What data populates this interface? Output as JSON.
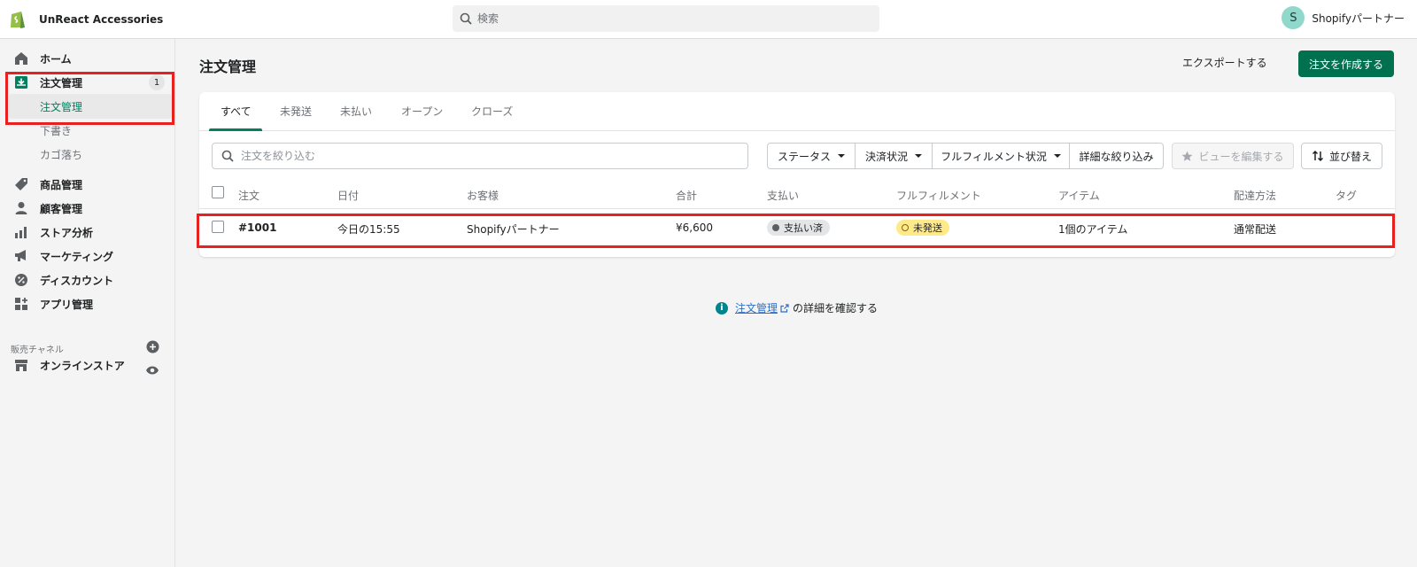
{
  "topbar": {
    "store_name": "UnReact Accessories",
    "search_placeholder": "検索",
    "user_initial": "S",
    "user_name": "Shopifyパートナー"
  },
  "sidebar": {
    "items": [
      {
        "label": "ホーム",
        "icon": "home-icon"
      },
      {
        "label": "注文管理",
        "icon": "orders-icon",
        "badge": "1"
      },
      {
        "label": "商品管理",
        "icon": "products-icon"
      },
      {
        "label": "顧客管理",
        "icon": "customers-icon"
      },
      {
        "label": "ストア分析",
        "icon": "analytics-icon"
      },
      {
        "label": "マーケティング",
        "icon": "marketing-icon"
      },
      {
        "label": "ディスカウント",
        "icon": "discount-icon"
      },
      {
        "label": "アプリ管理",
        "icon": "apps-icon"
      }
    ],
    "order_sub": [
      "注文管理",
      "下書き",
      "カゴ落ち"
    ],
    "sales_channels_label": "販売チャネル",
    "online_store": "オンラインストア"
  },
  "page": {
    "title": "注文管理",
    "export_label": "エクスポートする",
    "create_label": "注文を作成する"
  },
  "tabs": [
    "すべて",
    "未発送",
    "未払い",
    "オープン",
    "クローズ"
  ],
  "filters": {
    "search_placeholder": "注文を絞り込む",
    "status": "ステータス",
    "payment_status": "決済状況",
    "fulfillment_status": "フルフィルメント状況",
    "more_filters": "詳細な絞り込み",
    "edit_view": "ビューを編集する",
    "sort": "並び替え"
  },
  "table": {
    "headers": [
      "注文",
      "日付",
      "お客様",
      "合計",
      "支払い",
      "フルフィルメント",
      "アイテム",
      "配達方法",
      "タグ"
    ],
    "rows": [
      {
        "order": "#1001",
        "date": "今日の15:55",
        "customer": "Shopifyパートナー",
        "total": "¥6,600",
        "payment": "支払い済",
        "fulfillment": "未発送",
        "items": "1個のアイテム",
        "delivery": "通常配送",
        "tags": ""
      }
    ]
  },
  "footer_info": {
    "link_text": "注文管理",
    "suffix": "の詳細を確認する"
  },
  "colors": {
    "primary": "#00704e",
    "accent": "#008060",
    "highlight": "#e8201f",
    "paid_badge": "#e4e5e7",
    "unfulfilled_badge": "#ffea8a"
  }
}
